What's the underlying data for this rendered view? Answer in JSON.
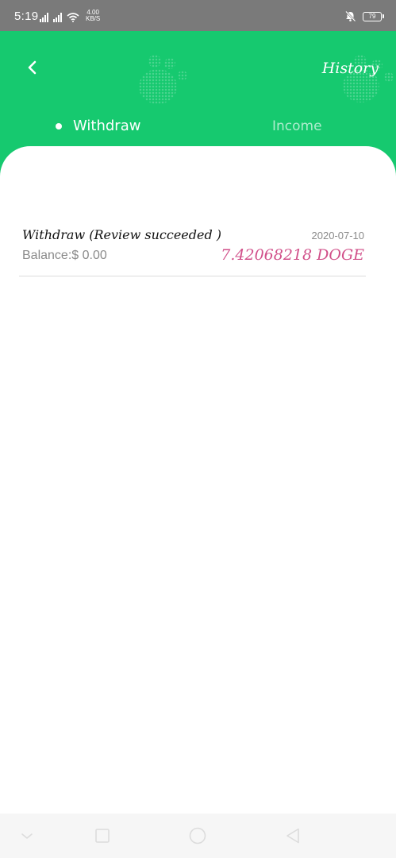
{
  "status_bar": {
    "time": "5:19",
    "network_speed_value": "4.00",
    "network_speed_unit": "KB/S",
    "battery_level": "79"
  },
  "header": {
    "history_label": "History",
    "tabs": [
      {
        "label": "Withdraw",
        "active": true
      },
      {
        "label": "Income",
        "active": false
      }
    ]
  },
  "records": [
    {
      "title": "Withdraw (Review succeeded )",
      "date": "2020-07-10",
      "balance": "Balance:$ 0.00",
      "amount": "7.42068218 DOGE"
    }
  ],
  "colors": {
    "brand_green": "#16c96f",
    "amount_pink": "#d1508a"
  },
  "icons": {
    "back": "chevron-left-icon",
    "nav_back": "triangle-back-icon",
    "nav_home": "circle-home-icon",
    "nav_recents": "square-recents-icon"
  }
}
